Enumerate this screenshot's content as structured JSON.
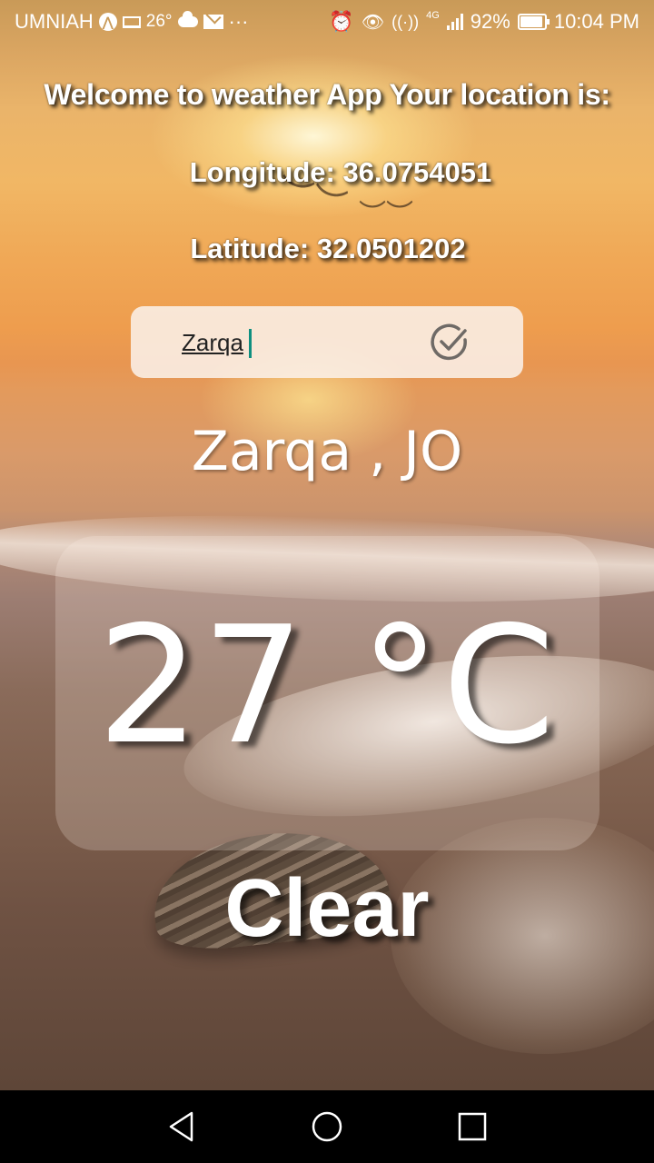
{
  "status_bar": {
    "carrier": "UMNIAH",
    "weather_temp": "26°",
    "more": "···",
    "network": "4G",
    "battery": "92%",
    "time": "10:04 PM"
  },
  "header": {
    "welcome": "Welcome to weather App  Your location is:",
    "longitude": "Longitude: 36.0754051",
    "latitude": "Latitude: 32.0501202"
  },
  "search": {
    "value": "Zarqa"
  },
  "location": "Zarqa , JO",
  "weather": {
    "temperature": "27 °C",
    "condition": "Clear"
  },
  "icons": {
    "search_confirm": "check-circle-icon",
    "nav_back": "back-triangle-icon",
    "nav_home": "home-circle-icon",
    "nav_recents": "recents-square-icon"
  }
}
